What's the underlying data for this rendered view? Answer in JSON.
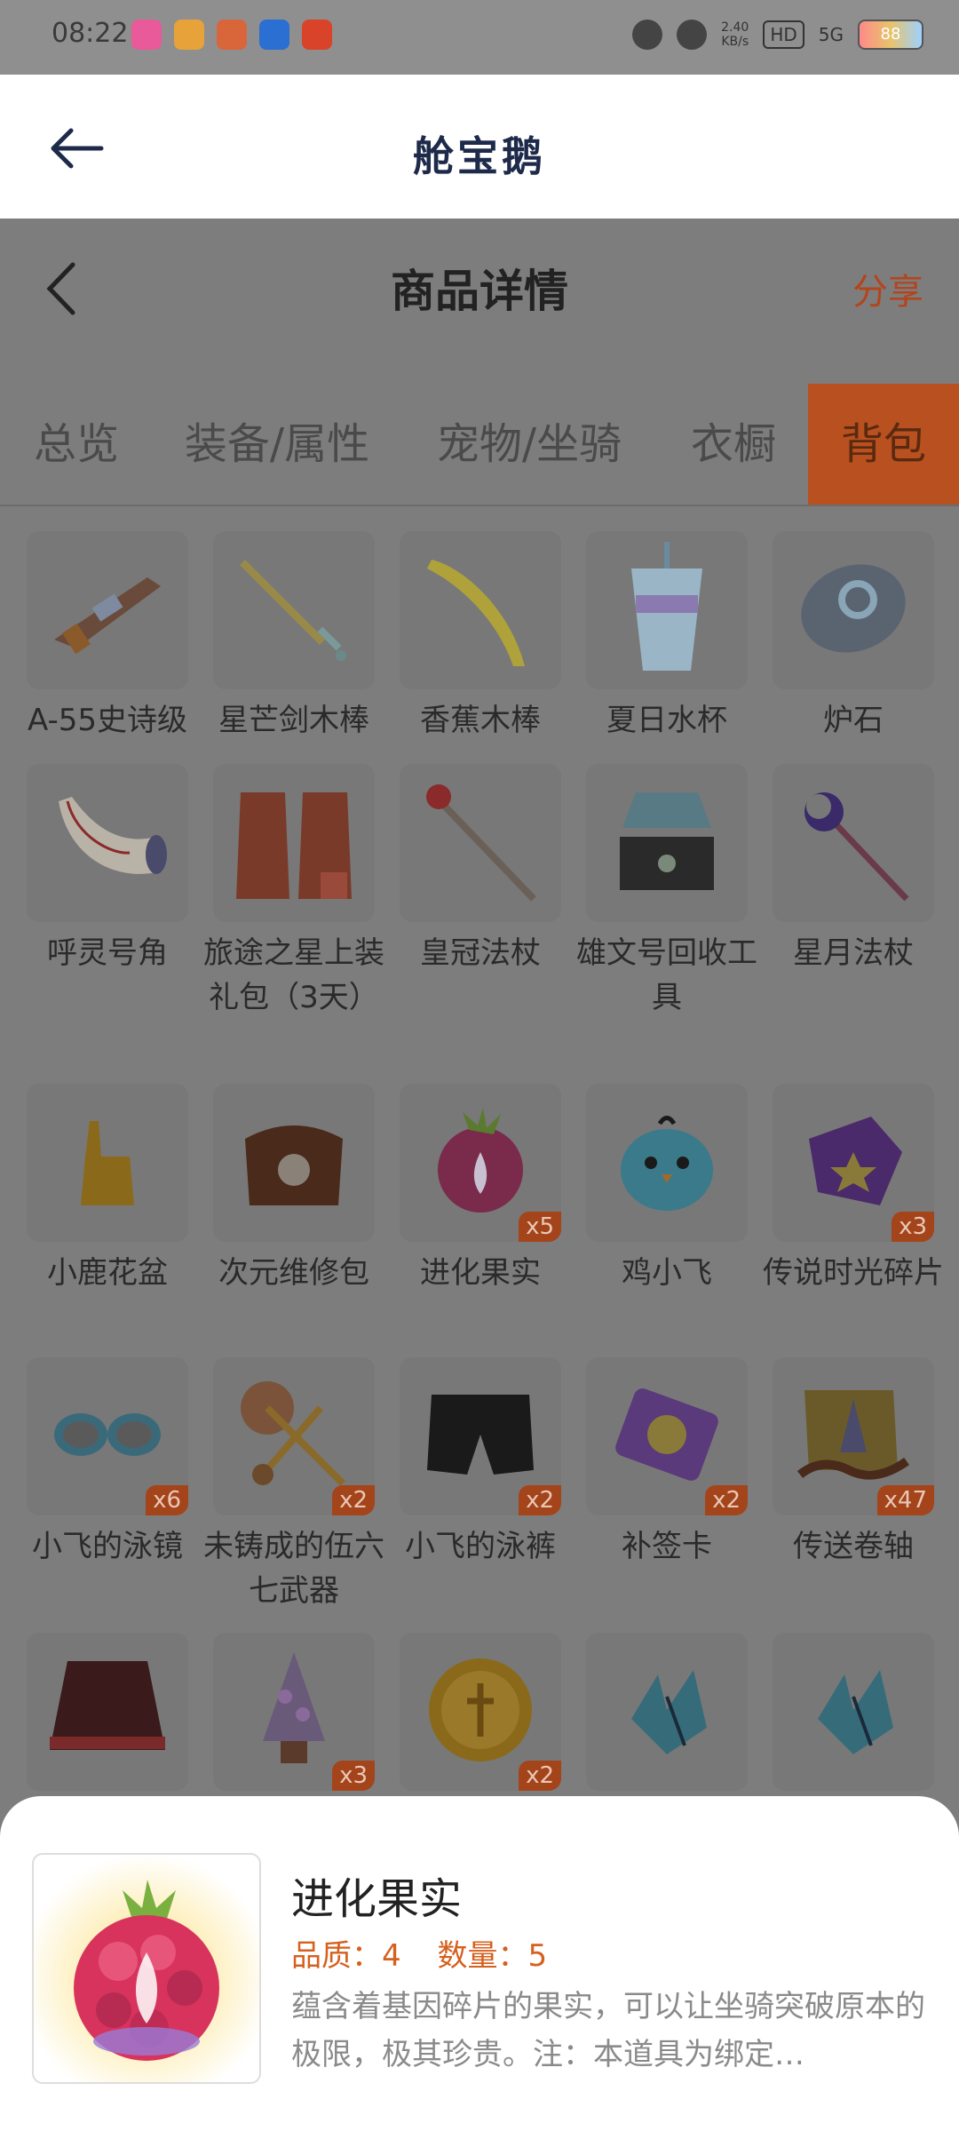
{
  "status_bar": {
    "time": "08:22",
    "speed": "2.40\nKB/s",
    "hd": "HD",
    "network": "5G",
    "battery": "88"
  },
  "app_header": {
    "title": "舱宝鹅"
  },
  "page_header": {
    "title": "商品详情",
    "share_label": "分享"
  },
  "tabs": [
    {
      "label": "总览"
    },
    {
      "label": "装备/属性"
    },
    {
      "label": "宠物/坐骑"
    },
    {
      "label": "衣橱"
    },
    {
      "label": "背包",
      "active": true
    }
  ],
  "items": [
    {
      "label": "A-55史诗级",
      "art": "gun-icon",
      "badge": ""
    },
    {
      "label": "星芒剑木棒",
      "art": "sword-icon",
      "badge": ""
    },
    {
      "label": "香蕉木棒",
      "art": "banana-icon",
      "badge": ""
    },
    {
      "label": "夏日水杯",
      "art": "cup-icon",
      "badge": ""
    },
    {
      "label": "炉石",
      "art": "hearthstone-icon",
      "badge": ""
    },
    {
      "label": "呼灵号角",
      "art": "horn-icon",
      "badge": ""
    },
    {
      "label": "旅途之星上装礼包（3天）",
      "art": "outfit-icon",
      "badge": ""
    },
    {
      "label": "皇冠法杖",
      "art": "staff-icon",
      "badge": ""
    },
    {
      "label": "雄文号回收工具",
      "art": "recycle-box-icon",
      "badge": ""
    },
    {
      "label": "星月法杖",
      "art": "moon-staff-icon",
      "badge": ""
    },
    {
      "label": "小鹿花盆",
      "art": "deer-pot-icon",
      "badge": ""
    },
    {
      "label": "次元维修包",
      "art": "repair-bag-icon",
      "badge": ""
    },
    {
      "label": "进化果实",
      "art": "berry-icon",
      "badge": "x5"
    },
    {
      "label": "鸡小飞",
      "art": "chick-icon",
      "badge": ""
    },
    {
      "label": "传说时光碎片",
      "art": "fragment-icon",
      "badge": "x3"
    },
    {
      "label": "小飞的泳镜",
      "art": "goggles-icon",
      "badge": "x6"
    },
    {
      "label": "未铸成的伍六七武器",
      "art": "scissors-icon",
      "badge": "x2"
    },
    {
      "label": "小飞的泳裤",
      "art": "shorts-icon",
      "badge": "x2"
    },
    {
      "label": "补签卡",
      "art": "card-icon",
      "badge": "x2"
    },
    {
      "label": "传送卷轴",
      "art": "scroll-icon",
      "badge": "x47"
    },
    {
      "label": "",
      "art": "skirt-icon",
      "badge": ""
    },
    {
      "label": "",
      "art": "flower-cone-icon",
      "badge": "x3"
    },
    {
      "label": "",
      "art": "coin-icon",
      "badge": "x2"
    },
    {
      "label": "",
      "art": "ice-crystal-icon",
      "badge": ""
    },
    {
      "label": "",
      "art": "ice-crystal-icon",
      "badge": ""
    }
  ],
  "detail": {
    "name": "进化果实",
    "quality": "品质：4",
    "quantity": "数量：5",
    "description": "蕴含着基因碎片的果实，可以让坐骑突破原本的极限，极其珍贵。注：本道具为绑定…"
  }
}
